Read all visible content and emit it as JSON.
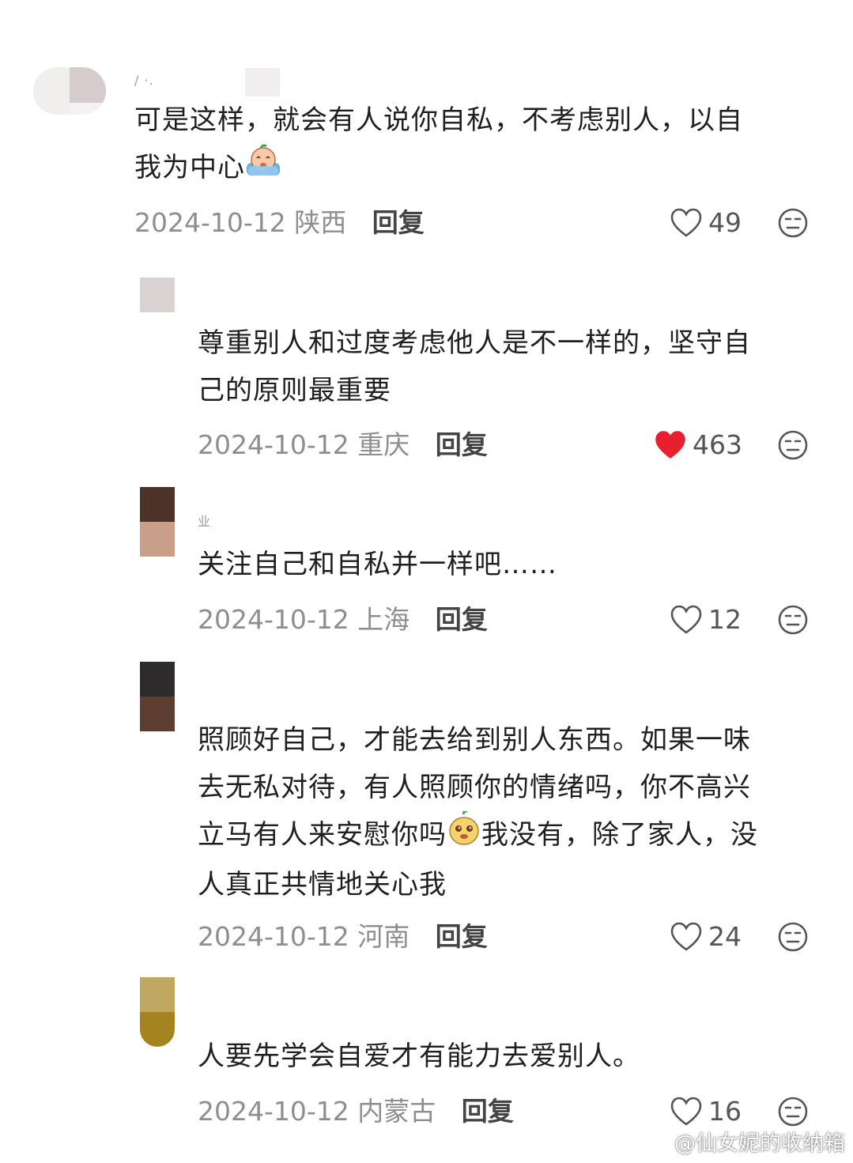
{
  "reply_label": "回复",
  "like_color": "#e8202e",
  "watermark": {
    "icon": "weibo-icon",
    "text": "@仙女妮的收纳箱"
  },
  "comments": [
    {
      "username": "/ ·.",
      "lines": [
        "可是这样，就会有人说你自私，不考虑别人，以自",
        "我为中心"
      ],
      "emoji": "crying-baby-emoji",
      "date": "2024-10-12",
      "location": "陕西",
      "likes": "49",
      "liked": false
    },
    {
      "username": "",
      "lines": [
        "尊重别人和过度考虑他人是不一样的，坚守自",
        "己的原则最重要"
      ],
      "date": "2024-10-12",
      "location": "重庆",
      "likes": "463",
      "liked": true
    },
    {
      "username": "业",
      "lines": [
        "关注自己和自私并一样吧……"
      ],
      "date": "2024-10-12",
      "location": "上海",
      "likes": "12",
      "liked": false
    },
    {
      "username": "",
      "lines": [
        "照顾好自己，才能去给到别人东西。如果一味",
        "去无私对待，有人照顾你的情绪吗，你不高兴",
        "立马有人来安慰你吗",
        "人真正共情地关心我"
      ],
      "line3_after_emoji": "我没有，除了家人，没",
      "emoji": "pear-face-emoji",
      "date": "2024-10-12",
      "location": "河南",
      "likes": "24",
      "liked": false
    },
    {
      "username": "",
      "lines": [
        "人要先学会自爱才有能力去爱别人。"
      ],
      "date": "2024-10-12",
      "location": "内蒙古",
      "likes": "16",
      "liked": false
    }
  ]
}
